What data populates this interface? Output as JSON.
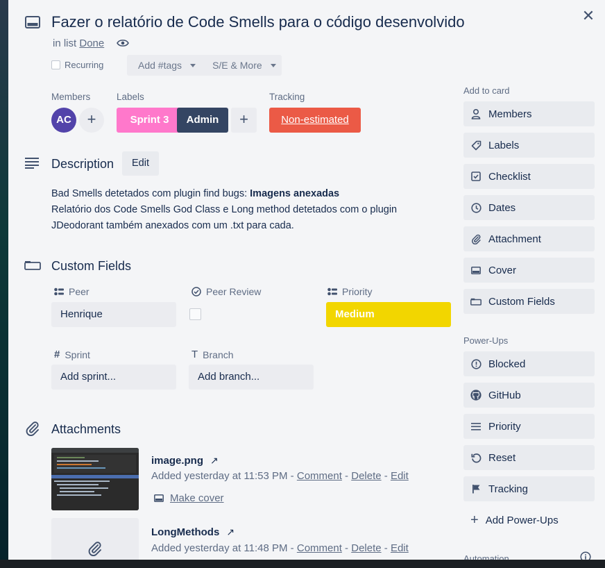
{
  "card": {
    "title": "Fazer o relatório de Code Smells para o código desenvolvido",
    "in_list_prefix": "in list",
    "list_name": "Done",
    "close_glyph": "✕",
    "recurring_label": "Recurring",
    "tags_label": "Add #tags",
    "se_more_label": "S/E & More"
  },
  "members": {
    "heading": "Members",
    "avatar_initials": "AC",
    "avatar_color": "#5243aa",
    "add_glyph": "+"
  },
  "labels": {
    "heading": "Labels",
    "items": [
      {
        "text": "Sprint 3",
        "color": "#ff78cb"
      },
      {
        "text": "Admin",
        "color": "#344563"
      }
    ],
    "add_glyph": "+"
  },
  "tracking": {
    "heading": "Tracking",
    "button_label": "Non-estimated",
    "color": "#eb5a46"
  },
  "description": {
    "heading": "Description",
    "edit_label": "Edit",
    "line1_prefix": "Bad Smells detetados com plugin find bugs: ",
    "line1_bold": "Imagens anexadas",
    "line2": "Relatório dos Code Smells God Class e Long method detetados com o plugin",
    "line3": "JDeodorant também anexados com um .txt para cada."
  },
  "custom_fields": {
    "heading": "Custom Fields",
    "peer": {
      "label": "Peer",
      "value": "Henrique"
    },
    "peer_review": {
      "label": "Peer Review",
      "checked": false
    },
    "priority": {
      "label": "Priority",
      "value": "Medium",
      "color": "#f2d600"
    },
    "sprint": {
      "label": "Sprint",
      "placeholder": "Add sprint..."
    },
    "branch": {
      "label": "Branch",
      "placeholder": "Add branch..."
    }
  },
  "attachments": {
    "heading": "Attachments",
    "items": [
      {
        "name": "image.png",
        "arrow": "↗",
        "added": "Added yesterday at 11:53 PM",
        "sep": " - ",
        "comment": "Comment",
        "delete": "Delete",
        "edit": "Edit",
        "make_cover": "Make cover"
      },
      {
        "name": "LongMethods",
        "arrow": "↗",
        "added": "Added yesterday at 11:48 PM",
        "sep": " - ",
        "comment": "Comment",
        "delete": "Delete",
        "edit": "Edit"
      }
    ]
  },
  "sidebar": {
    "add_to_card_heading": "Add to card",
    "add_to_card": [
      {
        "label": "Members",
        "icon": "person-icon"
      },
      {
        "label": "Labels",
        "icon": "tag-icon"
      },
      {
        "label": "Checklist",
        "icon": "checklist-icon"
      },
      {
        "label": "Dates",
        "icon": "clock-icon"
      },
      {
        "label": "Attachment",
        "icon": "paperclip-icon"
      },
      {
        "label": "Cover",
        "icon": "cover-icon"
      },
      {
        "label": "Custom Fields",
        "icon": "custom-fields-icon"
      }
    ],
    "power_ups_heading": "Power-Ups",
    "power_ups": [
      {
        "label": "Blocked",
        "icon": "alert-circle-icon"
      },
      {
        "label": "GitHub",
        "icon": "github-icon"
      },
      {
        "label": "Priority",
        "icon": "lines-icon"
      },
      {
        "label": "Reset",
        "icon": "reset-icon"
      },
      {
        "label": "Tracking",
        "icon": "flag-icon"
      }
    ],
    "add_power_ups": "Add Power-Ups",
    "add_power_ups_glyph": "+",
    "automation_heading": "Automation"
  }
}
